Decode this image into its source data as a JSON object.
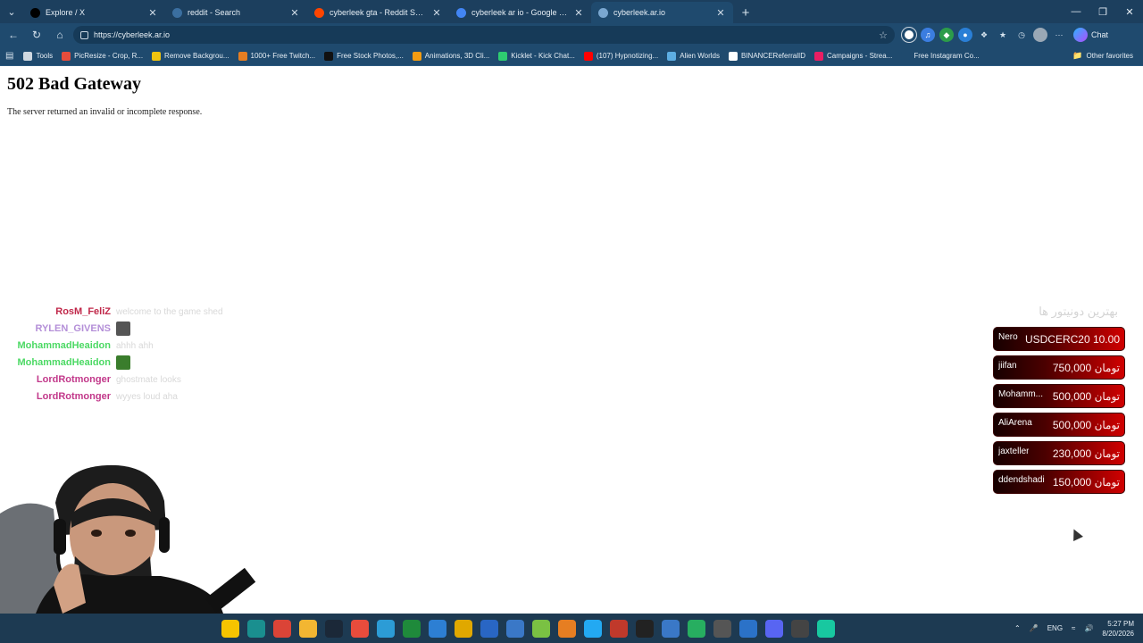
{
  "browser": {
    "tabs": [
      {
        "title": "Explore / X",
        "icon": "x-logo-icon",
        "color": "#000000",
        "active": false
      },
      {
        "title": "reddit - Search",
        "icon": "search-icon",
        "color": "#3b6fa0",
        "active": false
      },
      {
        "title": "cyberleek gta - Reddit Search!",
        "icon": "reddit-icon",
        "color": "#ff4500",
        "active": false
      },
      {
        "title": "cyberleek ar io - Google Search",
        "icon": "google-icon",
        "color": "#4285f4",
        "active": false
      },
      {
        "title": "cyberleek.ar.io",
        "icon": "globe-icon",
        "color": "#7aa7d0",
        "active": true
      }
    ],
    "url": "https://cyberleek.ar.io",
    "chat_label": "Chat",
    "bookmarks": [
      {
        "label": "Tools",
        "color": "#cfd8e0"
      },
      {
        "label": "PicResize - Crop, R...",
        "color": "#e74c3c"
      },
      {
        "label": "Remove Backgrou...",
        "color": "#f1c40f"
      },
      {
        "label": "1000+ Free Twitch...",
        "color": "#e67e22"
      },
      {
        "label": "Free Stock Photos,...",
        "color": "#111111"
      },
      {
        "label": "Animations, 3D Cli...",
        "color": "#f39c12"
      },
      {
        "label": "Kicklet - Kick Chat...",
        "color": "#2ecc71"
      },
      {
        "label": "(107) Hypnotizing...",
        "color": "#ff0000"
      },
      {
        "label": "Alien Worlds",
        "color": "#5dade2"
      },
      {
        "label": "BINANCEReferralID",
        "color": "#ffffff"
      },
      {
        "label": "Campaigns - Strea...",
        "color": "#e91e63"
      },
      {
        "label": "Free Instagram Co...",
        "color": "#1f4a6e"
      }
    ],
    "other_favorites": "Other favorites"
  },
  "page": {
    "heading": "502 Bad Gateway",
    "message": "The server returned an invalid or incomplete response."
  },
  "chat": [
    {
      "user": "RosM_FeliZ",
      "color": "#c0284a",
      "text": "welcome to the game shed",
      "emote": false
    },
    {
      "user": "RYLEN_GIVENS",
      "color": "#b48fd8",
      "text": "",
      "emote": true,
      "emote_color": "#555555"
    },
    {
      "user": "MohammadHeaidon",
      "color": "#4cd964",
      "text": "ahhh ahh",
      "emote": false
    },
    {
      "user": "MohammadHeaidon",
      "color": "#4cd964",
      "text": "",
      "emote": true,
      "emote_color": "#3a7d2c"
    },
    {
      "user": "LordRotmonger",
      "color": "#c2388a",
      "text": "ghostmate looks",
      "emote": false
    },
    {
      "user": "LordRotmonger",
      "color": "#c2388a",
      "text": "wyyes loud aha",
      "emote": false
    }
  ],
  "donors": {
    "heading": "بهترین دونیتور ها",
    "list": [
      {
        "name": "Nero",
        "amount": "USDCERC20 10.00"
      },
      {
        "name": "jiifan",
        "amount": "750,000 تومان"
      },
      {
        "name": "Mohamm...",
        "amount": "500,000 تومان"
      },
      {
        "name": "AliArena",
        "amount": "500,000 تومان"
      },
      {
        "name": "jaxteller",
        "amount": "230,000 تومان"
      },
      {
        "name": "ddendshadi",
        "amount": "150,000 تومان"
      }
    ]
  },
  "taskbar": {
    "apps": [
      {
        "name": "sticky-notes-icon",
        "color": "#f5c400"
      },
      {
        "name": "edge-icon",
        "color": "#1a8f8f"
      },
      {
        "name": "chrome-icon",
        "color": "#db4437"
      },
      {
        "name": "file-explorer-icon",
        "color": "#f2b632"
      },
      {
        "name": "steam-icon",
        "color": "#1b2838"
      },
      {
        "name": "maps-pin-icon",
        "color": "#e74c3c"
      },
      {
        "name": "app-icon-7",
        "color": "#2c9cd6"
      },
      {
        "name": "app-icon-8",
        "color": "#1f8a3b"
      },
      {
        "name": "app-icon-9",
        "color": "#2d7fd3"
      },
      {
        "name": "app-icon-10",
        "color": "#e0a800"
      },
      {
        "name": "app-icon-11",
        "color": "#2966c4"
      },
      {
        "name": "app-icon-12",
        "color": "#3a78c7"
      },
      {
        "name": "app-icon-13",
        "color": "#7ac143"
      },
      {
        "name": "app-icon-14",
        "color": "#e67e22"
      },
      {
        "name": "vscode-icon",
        "color": "#23a9f2"
      },
      {
        "name": "app-icon-16",
        "color": "#c0392b"
      },
      {
        "name": "app-icon-17",
        "color": "#222222"
      },
      {
        "name": "app-icon-18",
        "color": "#3a78c7"
      },
      {
        "name": "app-icon-19",
        "color": "#27ae60"
      },
      {
        "name": "calculator-icon",
        "color": "#555555"
      },
      {
        "name": "app-icon-21",
        "color": "#2b72c8"
      },
      {
        "name": "discord-icon",
        "color": "#5865f2"
      },
      {
        "name": "app-icon-23",
        "color": "#444444"
      },
      {
        "name": "app-icon-24",
        "color": "#18c8a0"
      }
    ],
    "language": "ENG",
    "time": "5:27 PM",
    "date": "8/20/2026"
  }
}
